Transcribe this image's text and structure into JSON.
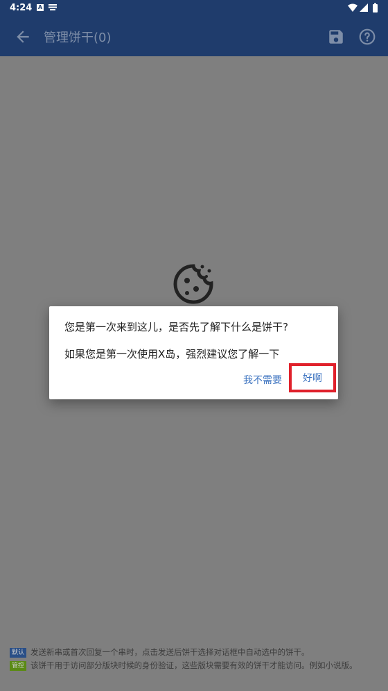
{
  "status_bar": {
    "time": "4:24",
    "notification_icons": [
      "font-app-icon",
      "keyboard-icon"
    ],
    "system_icons": [
      "wifi-icon",
      "signal-icon",
      "battery-icon"
    ]
  },
  "app_bar": {
    "title": "管理饼干(0)",
    "actions": [
      "save-icon",
      "help-icon"
    ]
  },
  "dialog": {
    "line1": "您是第一次来到这儿，是否先了解下什么是饼干?",
    "line2": "如果您是第一次使用X岛，强烈建议您了解一下",
    "negative_label": "我不需要",
    "positive_label": "好啊"
  },
  "footer": {
    "hints": [
      {
        "tag": "默认",
        "text": "发送新串或首次回复一个串时，点击发送后饼干选择对话框中自动选中的饼干。"
      },
      {
        "tag": "管控",
        "text": "该饼干用于访问部分版块时候的身份验证，这些版块需要有效的饼干才能访问。例如小说版。"
      }
    ]
  },
  "colors": {
    "app_bar": "#1f3c6c",
    "overlay_background": "#7f7f7f",
    "dialog_button_text": "#3c73c0",
    "highlight_border": "#e0212b",
    "tag_default": "#2a4f87",
    "tag_control": "#5a8a14"
  }
}
